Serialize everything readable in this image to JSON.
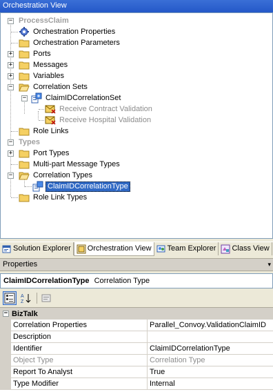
{
  "window": {
    "title": "Orchestration View"
  },
  "tree": {
    "process_root": "ProcessClaim",
    "orch_properties": "Orchestration Properties",
    "orch_parameters": "Orchestration Parameters",
    "ports": "Ports",
    "messages": "Messages",
    "variables": "Variables",
    "correlation_sets": "Correlation Sets",
    "claim_set": "ClaimIDCorrelationSet",
    "receive_contract": "Receive Contract Validation",
    "receive_hospital": "Receive Hospital Validation",
    "role_links": "Role Links",
    "types_root": "Types",
    "port_types": "Port Types",
    "multipart": "Multi-part Message Types",
    "correlation_types": "Correlation Types",
    "claim_type": "ClaimIDCorrelationType",
    "role_link_types": "Role Link Types"
  },
  "tabs": [
    {
      "label": "Solution Explorer",
      "icon": "solution-explorer-icon"
    },
    {
      "label": "Orchestration View",
      "icon": "orchestration-view-icon",
      "active": true
    },
    {
      "label": "Team Explorer",
      "icon": "team-explorer-icon"
    },
    {
      "label": "Class View",
      "icon": "class-view-icon"
    }
  ],
  "properties": {
    "header": "Properties",
    "object_name": "ClaimIDCorrelationType",
    "object_type": "Correlation Type",
    "category": "BizTalk",
    "rows": [
      {
        "name": "Correlation Properties",
        "value": "Parallel_Convoy.ValidationClaimID"
      },
      {
        "name": "Description",
        "value": ""
      },
      {
        "name": "Identifier",
        "value": "ClaimIDCorrelationType"
      },
      {
        "name": "Object Type",
        "value": "Correlation Type"
      },
      {
        "name": "Report To Analyst",
        "value": "True"
      },
      {
        "name": "Type Modifier",
        "value": "Internal"
      }
    ]
  },
  "colors": {
    "selection": "#316ac5",
    "title_bar": "#2458c8",
    "folder": "#f5d063"
  }
}
